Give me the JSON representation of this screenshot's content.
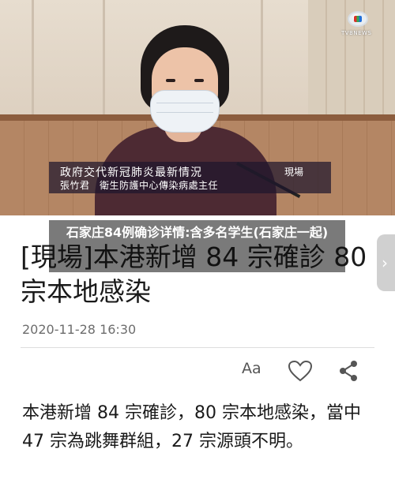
{
  "video": {
    "logo_text": "TVBNEWS",
    "caption": {
      "title": "政府交代新冠肺炎最新情況",
      "live_tag": "現場",
      "subtitle": "張竹君　衛生防護中心傳染病處主任"
    }
  },
  "overlay": {
    "title": "石家庄84例确诊详情:含多名学生(石家庄一起)"
  },
  "article": {
    "headline": "[現場]本港新增 84 宗確診 80 宗本地感染",
    "date": "2020-11-28 16:30",
    "toolbar": {
      "font_size_label": "Aa"
    },
    "body": "本港新增 84 宗確診，80 宗本地感染，當中 47 宗為跳舞群組，27 宗源頭不明。"
  },
  "nav": {
    "next_arrow": "›"
  },
  "icons": {
    "font_size": "font-size-icon",
    "favorite": "heart-icon",
    "share": "share-icon",
    "next": "chevron-right-icon"
  }
}
